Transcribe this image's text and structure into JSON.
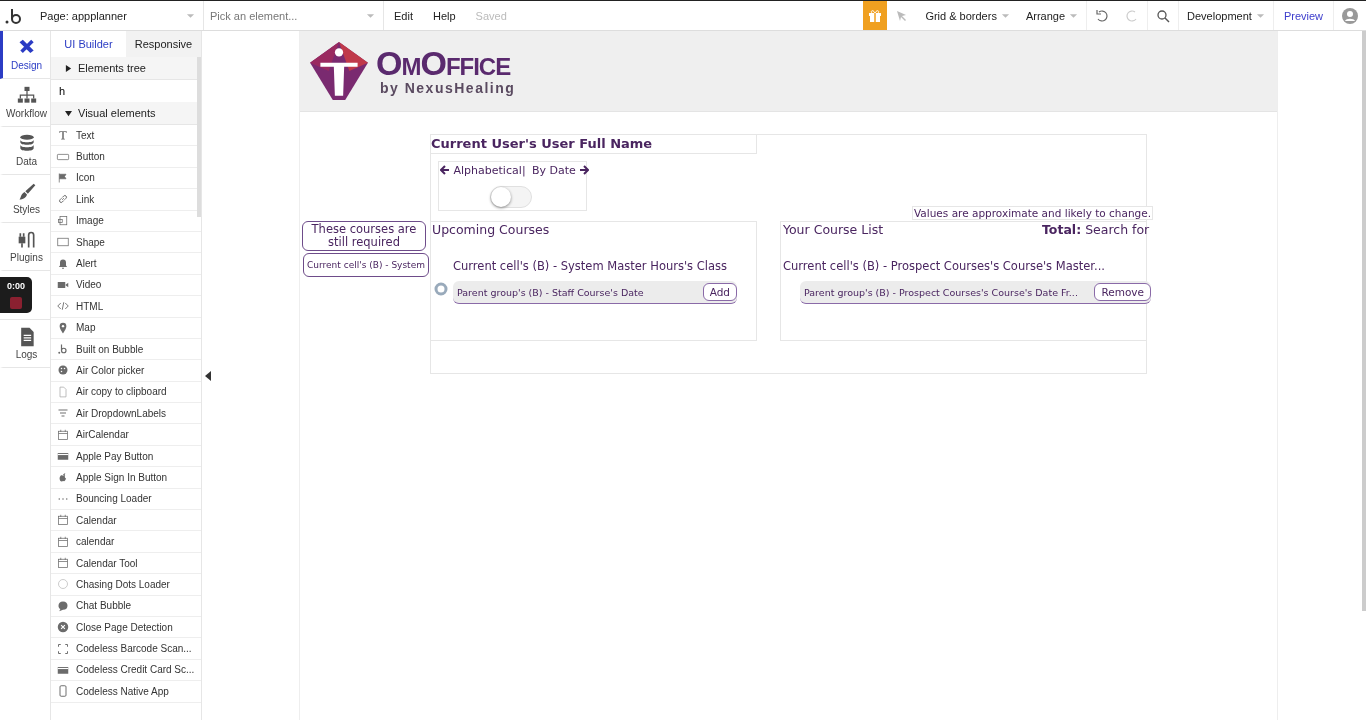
{
  "topbar": {
    "page_selector": "Page: appplanner",
    "element_picker": {
      "placeholder": "Pick an element..."
    },
    "menu": [
      "Edit",
      "Help"
    ],
    "save_status": "Saved",
    "grid_menu": "Grid & borders",
    "arrange_menu": "Arrange",
    "environment": "Development",
    "preview": "Preview"
  },
  "rail": [
    {
      "label": "Design",
      "selected": true
    },
    {
      "label": "Workflow",
      "selected": false
    },
    {
      "label": "Data",
      "selected": false
    },
    {
      "label": "Styles",
      "selected": false
    },
    {
      "label": "Plugins",
      "selected": false
    },
    {
      "label": "Logs",
      "selected": false
    }
  ],
  "recorder": {
    "time": "0:00"
  },
  "panel": {
    "tabs": [
      {
        "label": "UI Builder",
        "selected": true
      },
      {
        "label": "Responsive",
        "selected": false
      }
    ],
    "elements_tree": {
      "label": "Elements tree",
      "expanded": false
    },
    "search": {
      "value": "h"
    },
    "visual_elements": {
      "label": "Visual elements",
      "expanded": true,
      "items": [
        "Text",
        "Button",
        "Icon",
        "Link",
        "Image",
        "Shape",
        "Alert",
        "Video",
        "HTML",
        "Map",
        "Built on Bubble",
        "Air Color picker",
        "Air copy to clipboard",
        "Air DropdownLabels",
        "AirCalendar",
        "Apple Pay Button",
        "Apple Sign In Button",
        "Bouncing Loader",
        "Calendar",
        "calendar",
        "Calendar Tool",
        "Chasing Dots Loader",
        "Chat Bubble",
        "Close Page Detection",
        "Codeless Barcode Scan...",
        "Codeless Credit Card Sc...",
        "Codeless Native App"
      ]
    }
  },
  "canvas": {
    "logo": {
      "title": "OmOffice",
      "subtitle": "by NexusHealing"
    },
    "user_name": "Current User's User Full Name",
    "sort": {
      "left": "Alphabetical",
      "separator": "|",
      "right": "By Date",
      "toggle_on": false
    },
    "required_note": "These courses are still required",
    "system_cell": "Current cell's (B) - System",
    "upcoming_title": "Upcoming Courses",
    "upcoming_cell": "Current cell's (B) - System Master Hours's Class",
    "upcoming_row": {
      "text": "Parent group's (B) - Staff Course's Date",
      "button": "Add"
    },
    "disclaimer": "Values are approximate and likely to change.",
    "list_title": "Your  Course List",
    "total": "**Total:** Search for",
    "list_cell": "Current cell's (B) - Prospect Courses's Course's Master...",
    "list_row": {
      "text": "Parent group's (B) - Prospect Courses's Course's Date Fr...",
      "button": "Remove"
    }
  }
}
